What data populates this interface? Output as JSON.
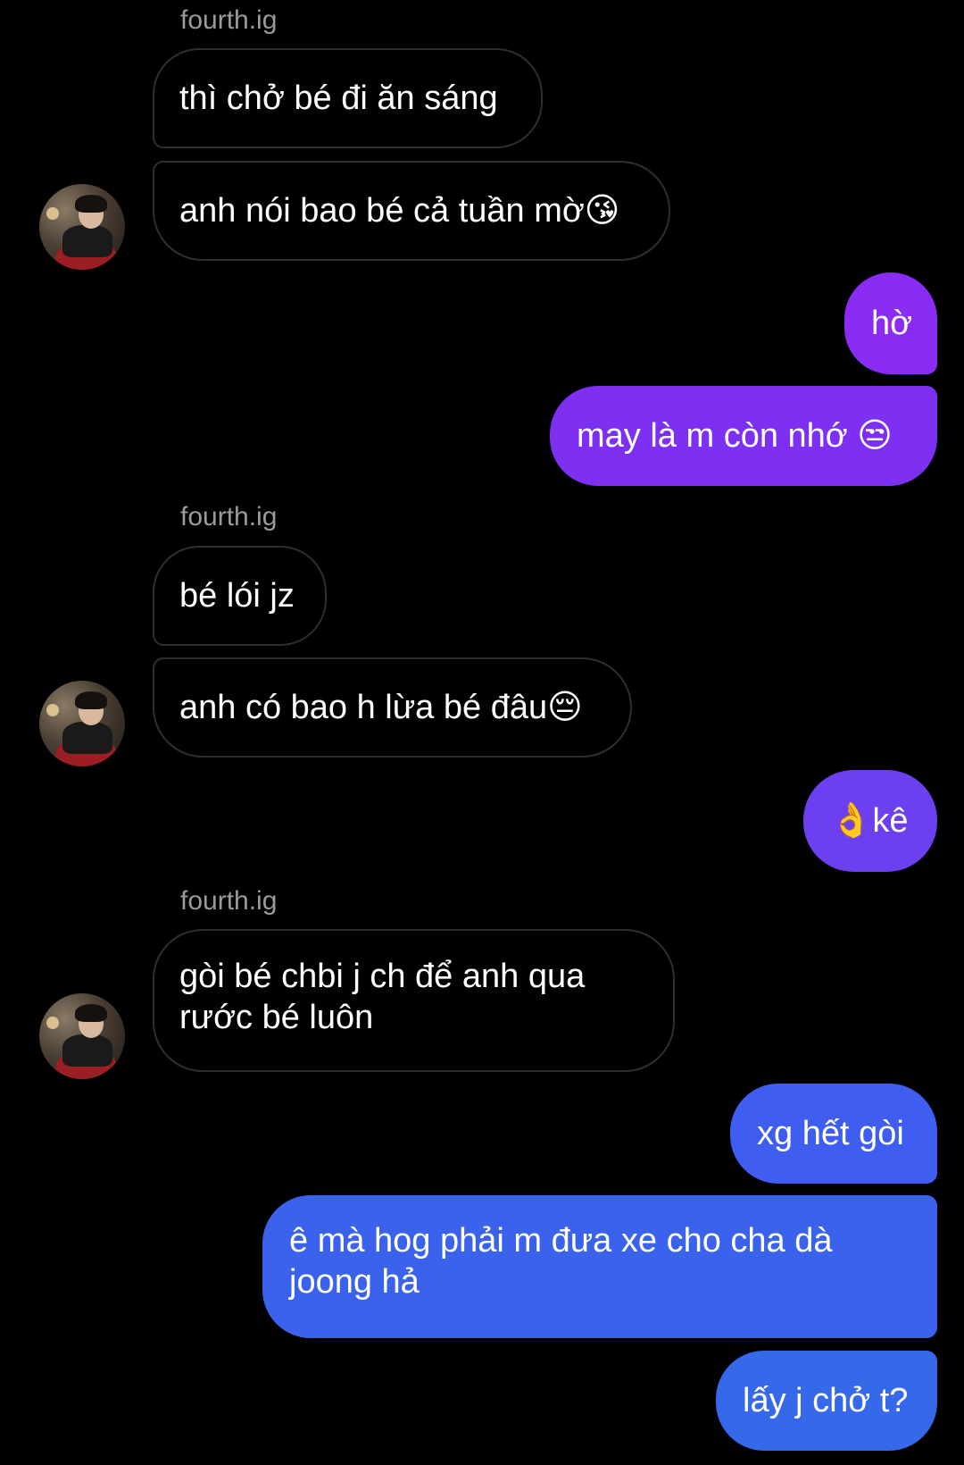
{
  "conversation": {
    "sender_name": "fourth.ig",
    "colors": {
      "background": "#000000",
      "incoming_border": "#2f2f2f",
      "outgoing_purple": "#8a2cf3",
      "outgoing_violet": "#6c3ff0",
      "outgoing_blue": "#3a62ec",
      "sender_label": "#9a9a9a"
    },
    "messages": [
      {
        "from": "fourth.ig",
        "text": "thì chở bé đi ăn sáng"
      },
      {
        "from": "fourth.ig",
        "text": "anh nói bao bé cả tuần mờ😘"
      },
      {
        "from": "me",
        "text": "hờ"
      },
      {
        "from": "me",
        "text": "may là m còn nhớ 😒"
      },
      {
        "from": "fourth.ig",
        "text": "bé lói jz"
      },
      {
        "from": "fourth.ig",
        "text": "anh có bao h lừa bé đâu😔"
      },
      {
        "from": "me",
        "text": "👌kê"
      },
      {
        "from": "fourth.ig",
        "text": "gòi bé chbi j ch để anh qua\nrước bé luôn"
      },
      {
        "from": "me",
        "text": "xg hết gòi"
      },
      {
        "from": "me",
        "text": "ê mà hog phải m đưa xe cho cha dà\njoong hả"
      },
      {
        "from": "me",
        "text": "lấy j chở t?"
      }
    ]
  }
}
